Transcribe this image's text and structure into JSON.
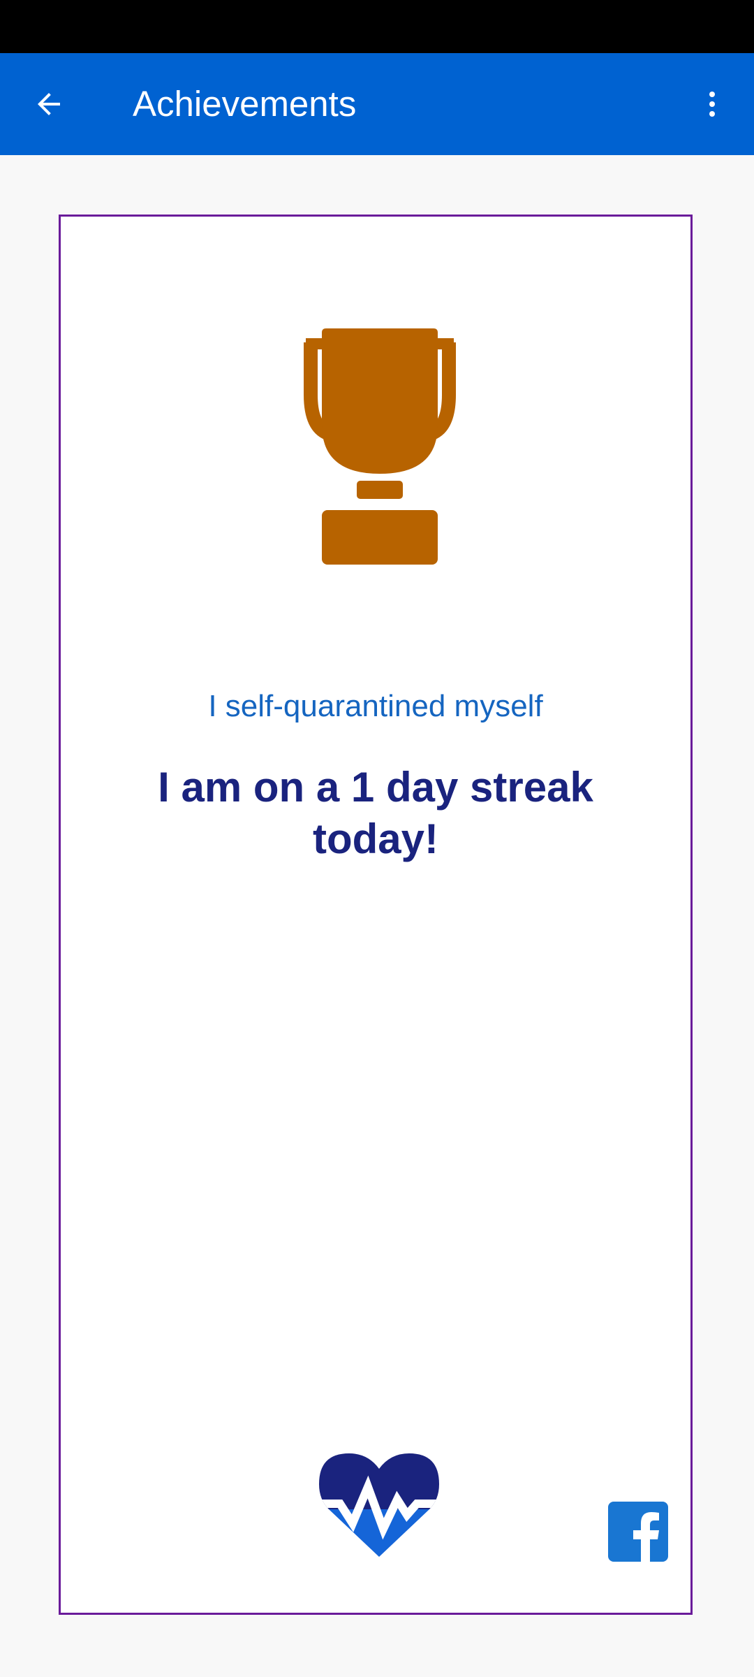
{
  "app_bar": {
    "title": "Achievements",
    "back_icon": "arrow-left-icon",
    "menu_icon": "more-vert-icon",
    "color": "#0062d1"
  },
  "achievement": {
    "icon": "trophy-icon",
    "icon_color": "#b76300",
    "subtitle": "I self-quarantined myself",
    "streak_text": "I am on a 1 day streak today!"
  },
  "footer": {
    "logo_icon": "heart-pulse-icon",
    "share_icon": "facebook-icon"
  },
  "colors": {
    "card_border": "#6a1b9a",
    "subtitle": "#1565c0",
    "streak": "#1a237e",
    "facebook": "#1976d2"
  }
}
